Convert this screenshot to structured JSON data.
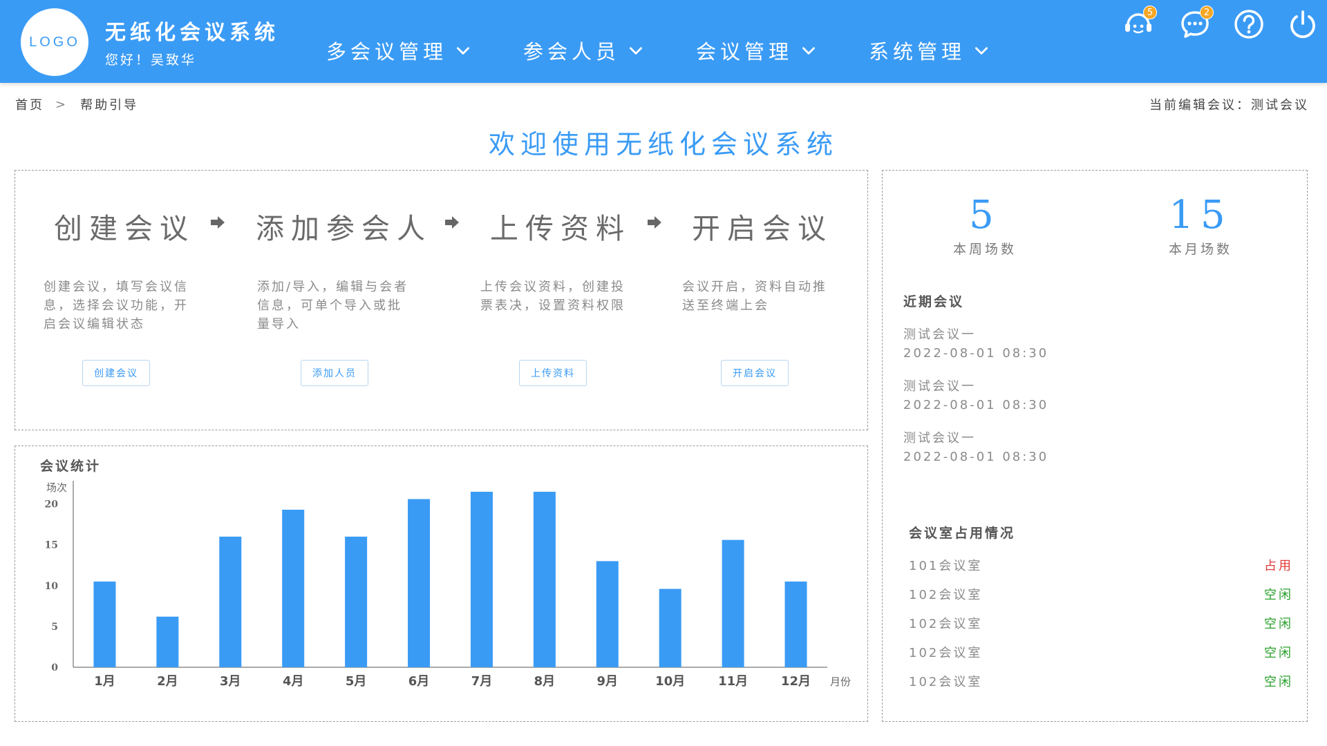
{
  "header": {
    "logo": "LOGO",
    "title": "无纸化会议系统",
    "greeting": "您好！吴致华",
    "nav": [
      "多会议管理",
      "参会人员",
      "会议管理",
      "系统管理"
    ],
    "badges": {
      "service": "5",
      "messages": "2"
    }
  },
  "breadcrumb": {
    "home": "首页",
    "current": "帮助引导"
  },
  "current_meeting": "当前编辑会议：测试会议",
  "page_title": "欢迎使用无纸化会议系统",
  "steps": [
    {
      "title": "创建会议",
      "desc": "创建会议，填写会议信息，选择会议功能，开启会议编辑状态",
      "button": "创建会议"
    },
    {
      "title": "添加参会人",
      "desc": "添加/导入，编辑与会者信息，可单个导入或批量导入",
      "button": "添加人员"
    },
    {
      "title": "上传资料",
      "desc": "上传会议资料，创建投票表决，设置资料权限",
      "button": "上传资料"
    },
    {
      "title": "开启会议",
      "desc": "会议开启，资料自动推送至终端上会",
      "button": "开启会议"
    }
  ],
  "stats": {
    "week_count": "5",
    "week_label": "本周场数",
    "month_count": "15",
    "month_label": "本月场数"
  },
  "recent": {
    "heading": "近期会议",
    "items": [
      {
        "name": "测试会议一",
        "time": "2022-08-01 08:30"
      },
      {
        "name": "测试会议一",
        "time": "2022-08-01 08:30"
      },
      {
        "name": "测试会议一",
        "time": "2022-08-01 08:30"
      }
    ]
  },
  "rooms": {
    "heading": "会议室占用情况",
    "items": [
      {
        "name": "101会议室",
        "status": "占用",
        "state": "busy"
      },
      {
        "name": "102会议室",
        "status": "空闲",
        "state": "free"
      },
      {
        "name": "102会议室",
        "status": "空闲",
        "state": "free"
      },
      {
        "name": "102会议室",
        "status": "空闲",
        "state": "free"
      },
      {
        "name": "102会议室",
        "status": "空闲",
        "state": "free"
      }
    ]
  },
  "colors": {
    "brand": "#3a9bf5",
    "bar": "#3a9bf5",
    "busy": "#e03a3a",
    "free": "#2aa02a"
  },
  "chart_data": {
    "type": "bar",
    "title": "会议统计",
    "ylabel": "场次",
    "xlabel": "月份",
    "categories": [
      "1月",
      "2月",
      "3月",
      "4月",
      "5月",
      "6月",
      "7月",
      "8月",
      "9月",
      "10月",
      "11月",
      "12月"
    ],
    "values": [
      10.5,
      6.2,
      16,
      19.3,
      16,
      20.6,
      21.5,
      21.5,
      13,
      9.6,
      15.6,
      10.5
    ],
    "yticks": [
      0,
      5,
      10,
      15,
      20
    ],
    "ylim": [
      0,
      22
    ],
    "grid": false,
    "legend": "none"
  }
}
